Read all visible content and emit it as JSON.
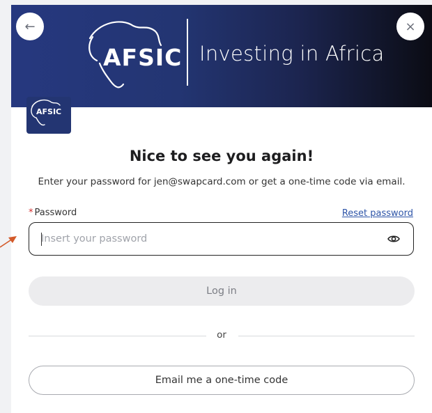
{
  "banner": {
    "brand": "AFSIC",
    "tagline": "Investing in Africa",
    "back_icon": "←",
    "close_icon": "×",
    "gradient": [
      "#26387f",
      "#0b0c14"
    ]
  },
  "small_logo": {
    "brand": "AFSIC"
  },
  "login": {
    "heading": "Nice to see you again!",
    "subtext": "Enter your password for jen@swapcard.com or get a one-time code via email.",
    "password_label": "Password",
    "required_marker": "*",
    "reset_link": "Reset password",
    "password_placeholder": "Insert your password",
    "password_value": "",
    "show_password_icon": "eye-icon",
    "login_button": "Log in",
    "divider_text": "or",
    "otp_button": "Email me a one-time code"
  },
  "colors": {
    "brand_navy": "#233572",
    "link": "#2e55a8",
    "required": "#d22d2d",
    "annotation_arrow": "#d35a2a"
  }
}
